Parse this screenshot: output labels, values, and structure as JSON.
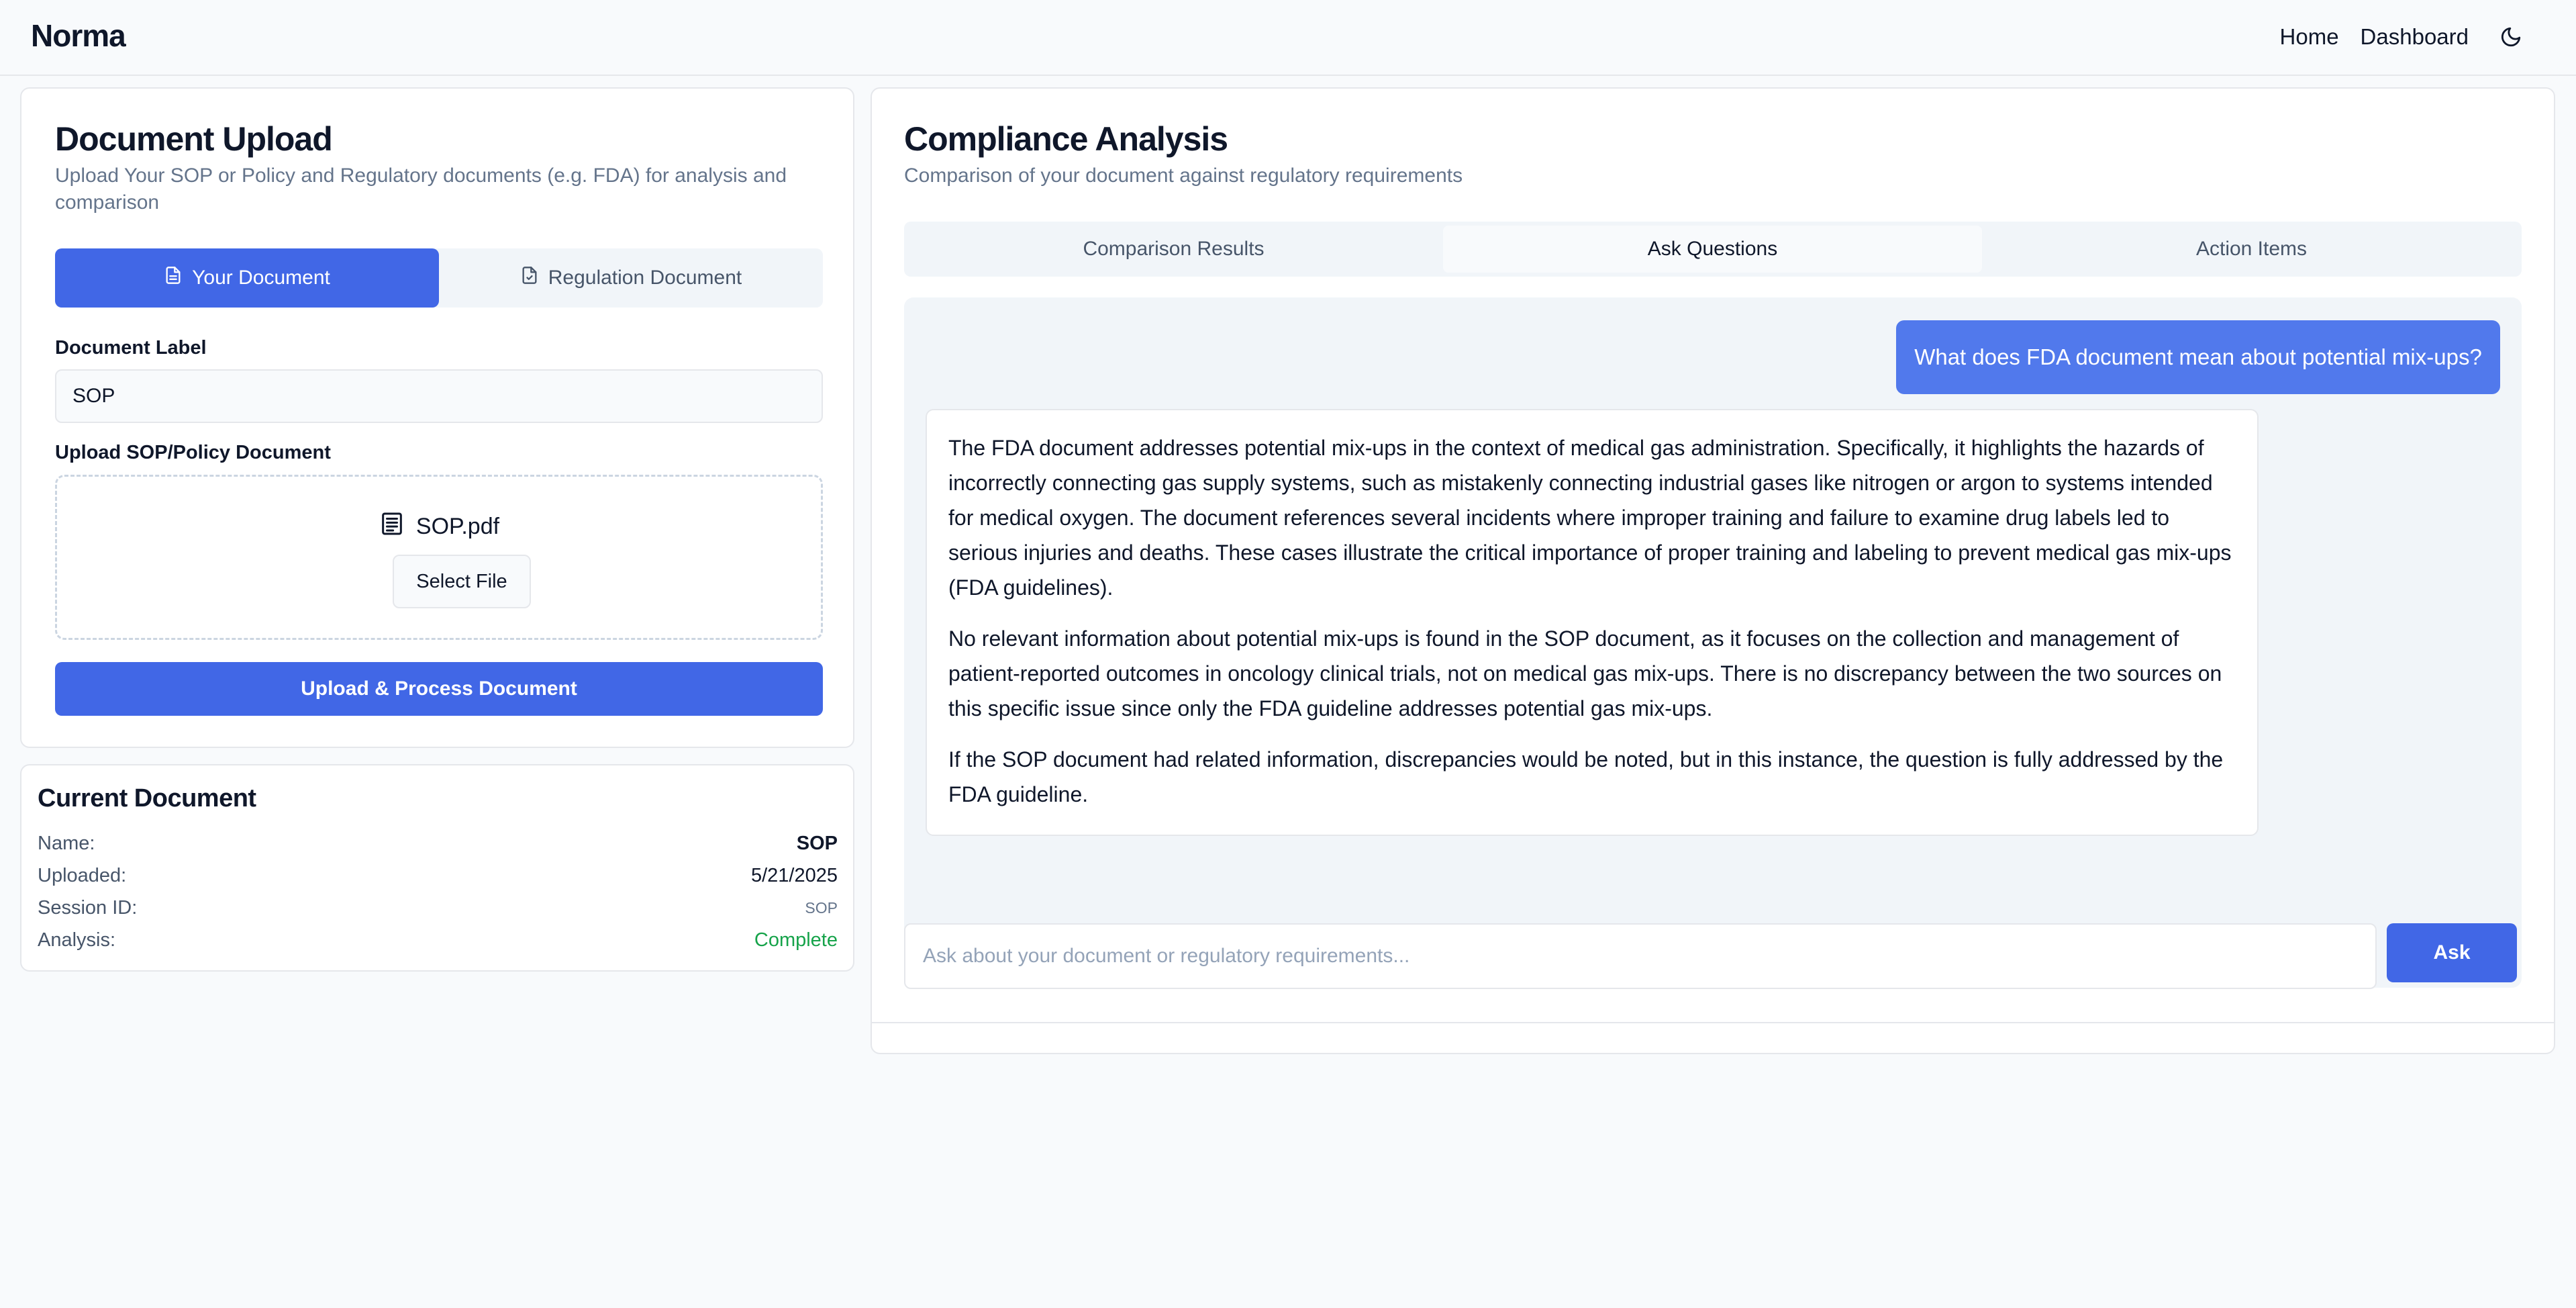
{
  "header": {
    "brand": "Norma",
    "nav": [
      {
        "label": "Home"
      },
      {
        "label": "Dashboard"
      }
    ],
    "theme_icon": "moon-icon"
  },
  "upload": {
    "title": "Document Upload",
    "subtitle": "Upload Your SOP or Policy and Regulatory documents (e.g. FDA) for analysis and comparison",
    "tabs": [
      {
        "label": "Your Document",
        "icon": "file-text-icon",
        "active": true
      },
      {
        "label": "Regulation Document",
        "icon": "file-check-icon",
        "active": false
      }
    ],
    "label_field_label": "Document Label",
    "label_value": "SOP",
    "upload_field_label": "Upload SOP/Policy Document",
    "file_name": "SOP.pdf",
    "select_button": "Select File",
    "process_button": "Upload & Process Document"
  },
  "current_document": {
    "title": "Current Document",
    "rows": [
      {
        "label": "Name:",
        "value": "SOP"
      },
      {
        "label": "Uploaded:",
        "value": "5/21/2025"
      },
      {
        "label": "Session ID:",
        "value": "SOP"
      },
      {
        "label": "Analysis:",
        "value": "Complete"
      }
    ],
    "status_color": "#16a34a"
  },
  "analysis": {
    "title": "Compliance Analysis",
    "subtitle": "Comparison of your document against regulatory requirements",
    "tabs": [
      {
        "label": "Comparison Results"
      },
      {
        "label": "Ask Questions",
        "active": true
      },
      {
        "label": "Action Items"
      }
    ],
    "user_message": "What does FDA document mean about potential mix-ups?",
    "bot_paragraphs": [
      "The FDA document addresses potential mix-ups in the context of medical gas administration. Specifically, it highlights the hazards of incorrectly connecting gas supply systems, such as mistakenly connecting industrial gases like nitrogen or argon to systems intended for medical oxygen. The document references several incidents where improper training and failure to examine drug labels led to serious injuries and deaths. These cases illustrate the critical importance of proper training and labeling to prevent medical gas mix-ups (FDA guidelines).",
      "No relevant information about potential mix-ups is found in the SOP document, as it focuses on the collection and management of patient-reported outcomes in oncology clinical trials, not on medical gas mix-ups. There is no discrepancy between the two sources on this specific issue since only the FDA guideline addresses potential gas mix-ups.",
      "If the SOP document had related information, discrepancies would be noted, but in this instance, the question is fully addressed by the FDA guideline."
    ],
    "ask_placeholder": "Ask about your document or regulatory requirements...",
    "ask_button": "Ask"
  },
  "colors": {
    "accent": "#4167e6",
    "user_bubble": "#5179ec",
    "success": "#16a34a"
  }
}
